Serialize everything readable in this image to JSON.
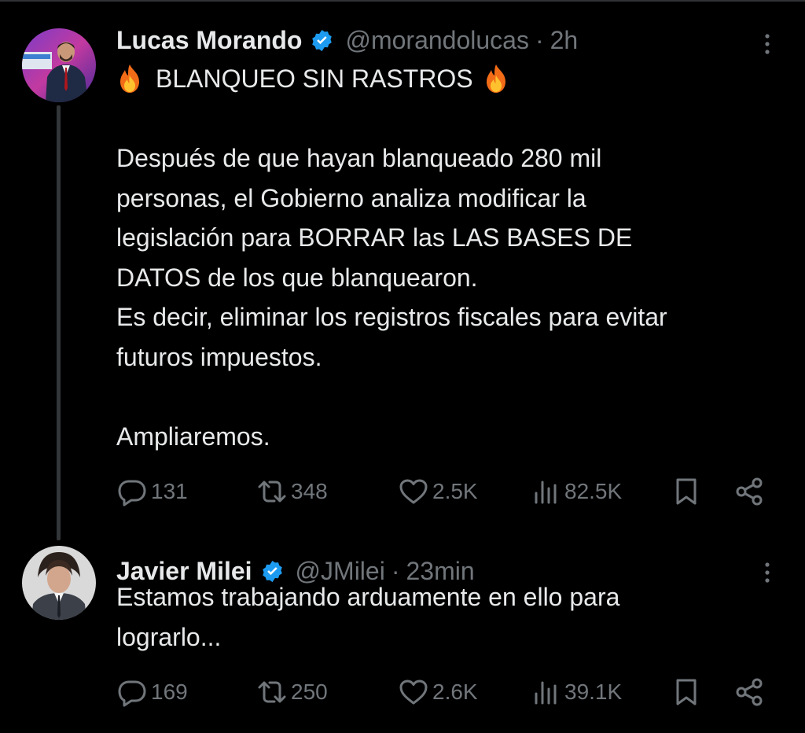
{
  "tweets": [
    {
      "author_name": "Lucas Morando",
      "handle": "@morandolucas",
      "separator": "·",
      "time": "2h",
      "headline": "BLANQUEO SIN RASTROS",
      "headline_emoji": "fire-emoji",
      "body_lines": [
        "Después de que hayan blanqueado 280 mil",
        "personas, el Gobierno analiza modificar la",
        "legislación para BORRAR las LAS BASES DE",
        "DATOS  de los que blanquearon.",
        "Es decir, eliminar los registros fiscales para evitar",
        "futuros impuestos."
      ],
      "closing": "Ampliaremos.",
      "stats": {
        "replies": "131",
        "retweets": "348",
        "likes": "2.5K",
        "views": "82.5K"
      }
    },
    {
      "author_name": "Javier Milei",
      "handle": "@JMilei",
      "separator": "·",
      "time": "23min",
      "body_lines": [
        "Estamos trabajando arduamente en ello para",
        "lograrlo..."
      ],
      "stats": {
        "replies": "169",
        "retweets": "250",
        "likes": "2.6K",
        "views": "39.1K"
      }
    }
  ],
  "icons": {
    "verified": "verified-badge-icon",
    "more": "more-options-icon",
    "reply": "reply-icon",
    "retweet": "retweet-icon",
    "like": "heart-icon",
    "views": "views-icon",
    "bookmark": "bookmark-icon",
    "share": "share-icon"
  },
  "colors": {
    "background": "#000000",
    "text": "#e7e9ea",
    "muted": "#71767b",
    "verified": "#1d9bf0",
    "thread_line": "#333639"
  }
}
